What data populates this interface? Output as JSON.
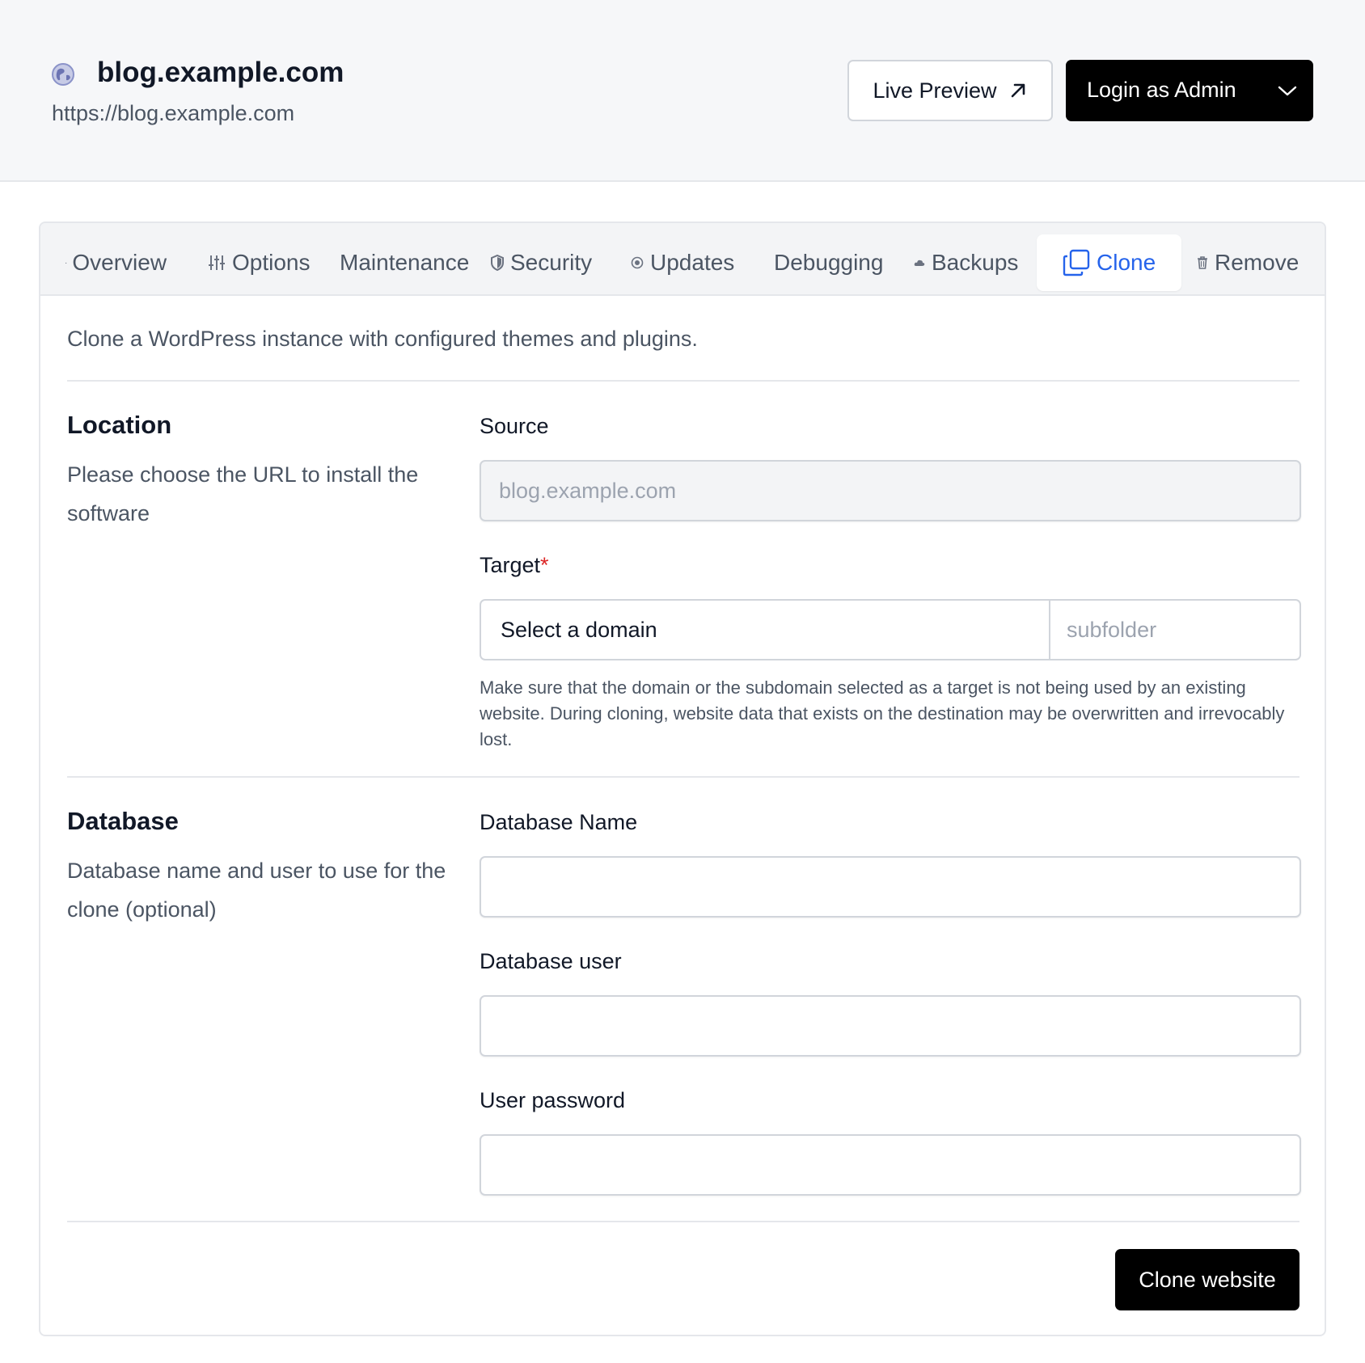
{
  "header": {
    "site_title": "blog.example.com",
    "site_url": "https://blog.example.com",
    "site_icon": "globe-icon",
    "live_preview_label": "Live Preview",
    "login_label": "Login as Admin"
  },
  "tabs": [
    {
      "label": "Overview",
      "icon": "overview-icon"
    },
    {
      "label": "Options",
      "icon": "sliders-icon"
    },
    {
      "label": "Maintenance",
      "icon": ""
    },
    {
      "label": "Security",
      "icon": "shield-icon"
    },
    {
      "label": "Updates",
      "icon": "updates-icon"
    },
    {
      "label": "Debugging",
      "icon": ""
    },
    {
      "label": "Backups",
      "icon": "cloud-icon"
    },
    {
      "label": "Clone",
      "icon": "copy-icon",
      "active": true
    },
    {
      "label": "Remove",
      "icon": "trash-icon"
    }
  ],
  "intro": "Clone a WordPress instance with configured themes and plugins.",
  "location": {
    "title": "Location",
    "description": "Please choose the URL to install the software",
    "source_label": "Source",
    "source_value": "blog.example.com",
    "target_label": "Target",
    "target_required": "*",
    "domain_select": "Select a domain",
    "subfolder_placeholder": "subfolder",
    "help_text": "Make sure that the domain or the subdomain selected as a target is not being used by an existing website. During cloning, website data that exists on the destination may be overwritten and irrevocably lost."
  },
  "database": {
    "title": "Database",
    "description": "Database name and user to use for the clone (optional)",
    "name_label": "Database Name",
    "name_value": "",
    "user_label": "Database user",
    "user_value": "",
    "password_label": "User password",
    "password_value": ""
  },
  "submit_label": "Clone website",
  "colors": {
    "accent": "#2563eb",
    "primary_button": "#000000",
    "required": "#dc2626",
    "header_bg": "#f6f7f9"
  }
}
